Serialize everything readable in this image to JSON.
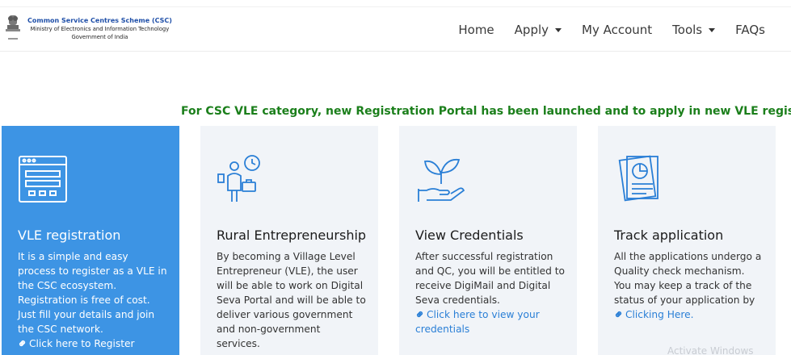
{
  "header": {
    "title": "Common Service Centres Scheme (CSC)",
    "ministry": "Ministry of Electronics and Information Technology",
    "government": "Government of India"
  },
  "nav": {
    "home": "Home",
    "apply": "Apply",
    "account": "My Account",
    "tools": "Tools",
    "faqs": "FAQs"
  },
  "announcement": "For CSC VLE category, new Registration Portal has been launched and to apply in new VLE registration pro",
  "cards": [
    {
      "title": "VLE registration",
      "body": "It is a simple and easy process to register as a VLE in the CSC ecosystem. Registration is free of cost. Just fill your details and join the CSC network.",
      "link": "Click here to Register",
      "icon": "browser-form-icon"
    },
    {
      "title": "Rural Entrepreneurship",
      "body": "By becoming a Village Level Entrepreneur (VLE), the user will be able to work on Digital Seva Portal and will be able to deliver various government and non-government services.",
      "icon": "entrepreneur-icon"
    },
    {
      "title": "View Credentials",
      "body": "After successful registration and QC, you will be entitled to receive DigiMail and Digital Seva credentials.",
      "link": "Click here to view your credentials",
      "icon": "plant-hand-icon"
    },
    {
      "title": "Track application",
      "body": "All the applications undergo a Quality check mechanism. You may keep a track of the status of your application by",
      "link": "Clicking Here.",
      "icon": "report-chart-icon"
    }
  ],
  "colors": {
    "accent_blue": "#3d94e4",
    "link_blue": "#2a7fd6",
    "announcement_green": "#1b7f1b",
    "card_gray": "#f1f4f8"
  },
  "watermark": "Activate Windows"
}
